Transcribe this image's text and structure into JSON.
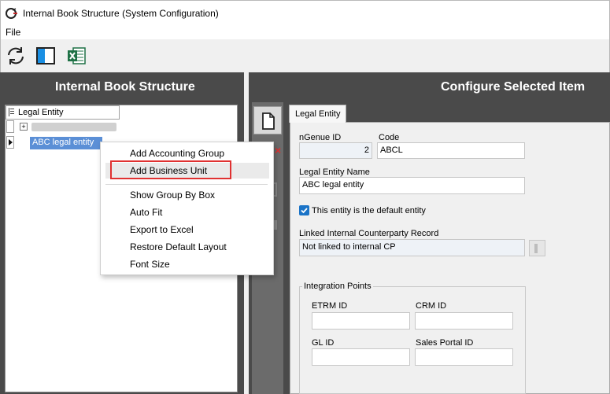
{
  "window": {
    "title": "Internal Book Structure (System Configuration)"
  },
  "menu": {
    "file": "File"
  },
  "toolbar": {
    "refresh_icon": "refresh-icon",
    "layout_icon": "panel-layout-icon",
    "excel_icon": "excel-icon"
  },
  "left_panel": {
    "header": "Internal Book Structure",
    "tree_column": "Legal Entity",
    "rows": [
      "",
      "ABC legal entity"
    ]
  },
  "context_menu": {
    "items": [
      "Add Accounting Group",
      "Add Business Unit",
      "Show Group By Box",
      "Auto Fit",
      "Export to Excel",
      "Restore Default Layout",
      "Font Size"
    ],
    "highlighted": "Add Business Unit"
  },
  "right_panel": {
    "header": "Configure Selected Item",
    "tab": "Legal Entity",
    "ngenue_id_label": "nGenue ID",
    "ngenue_id_value": "2",
    "code_label": "Code",
    "code_value": "ABCL",
    "name_label": "Legal Entity Name",
    "name_value": "ABC legal entity",
    "default_checkbox_label": "This entity is the default entity",
    "default_checked": true,
    "linked_label": "Linked Internal Counterparty Record",
    "linked_value": "Not linked to internal CP",
    "integration": {
      "title": "Integration Points",
      "etrm_label": "ETRM ID",
      "crm_label": "CRM ID",
      "gl_label": "GL ID",
      "sales_label": "Sales Portal ID"
    }
  },
  "colors": {
    "accent": "#e03131",
    "panel_dark": "#4a4a4a",
    "excel_green": "#1e7145",
    "checkbox_blue": "#1a73c7"
  }
}
